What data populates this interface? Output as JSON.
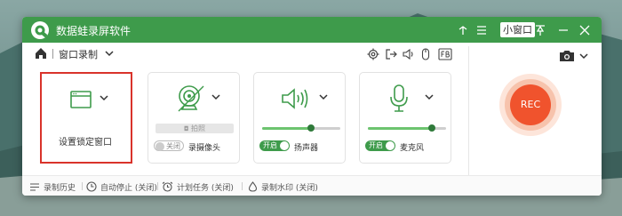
{
  "app": {
    "title": "数据蛙录屏软件",
    "mini_window_label": "小窗口",
    "accent": "#3e9b4b",
    "rec_color": "#f0532d"
  },
  "titlebar_icons": [
    "pin-icon",
    "menu-icon",
    "minimize-icon",
    "restore-icon",
    "close-icon"
  ],
  "subbar": {
    "mode_label": "窗口录制",
    "tools": [
      "settings-icon",
      "export-icon",
      "speaker-icon",
      "mouse-icon",
      "fb-icon"
    ]
  },
  "cards": {
    "window": {
      "label": "设置锁定窗口"
    },
    "webcam": {
      "snap_label": "拍照",
      "toggle_label": "关闭",
      "name": "录摄像头"
    },
    "speaker": {
      "toggle_label": "开启",
      "name": "扬声器",
      "volume": 0.62
    },
    "mic": {
      "toggle_label": "开启",
      "name": "麦克风",
      "volume": 0.82
    }
  },
  "rec": {
    "label": "REC"
  },
  "footer": {
    "history": "录制历史",
    "auto_stop": "自动停止 (关闭)",
    "schedule": "计划任务 (关闭)",
    "watermark": "录制水印 (关闭)"
  }
}
